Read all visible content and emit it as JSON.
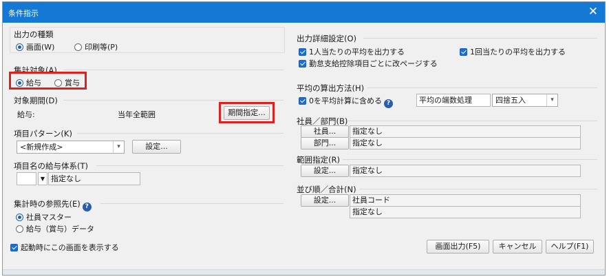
{
  "window": {
    "title": "条件指示",
    "close_glyph": "✕"
  },
  "output_type": {
    "title": "出力の種類",
    "options": [
      {
        "label": "画面(W)",
        "selected": true
      },
      {
        "label": "印刷等(P)",
        "selected": false
      }
    ]
  },
  "aggregate_target": {
    "title": "集計対象(A)",
    "options": [
      {
        "label": "給与",
        "selected": true
      },
      {
        "label": "賞与",
        "selected": false
      }
    ]
  },
  "period": {
    "title": "対象期間(D)",
    "label": "給与:",
    "value": "当年全範囲",
    "button": "期間指定..."
  },
  "item_pattern": {
    "title": "項目パターン(K)",
    "select_value": "<新規作成>",
    "settings_button": "設定..."
  },
  "salary_system": {
    "title": "項目名の給与体系(T)",
    "value": "指定なし"
  },
  "reference": {
    "title": "集計時の参照先(E)",
    "options": [
      {
        "label": "社員マスター",
        "selected": true
      },
      {
        "label": "給与（賞与）データ",
        "selected": false
      }
    ]
  },
  "startup_check": {
    "label": "起動時にこの画面を表示する",
    "checked": true
  },
  "output_details": {
    "title": "出力詳細設定(O)",
    "checks": [
      {
        "label": "1人当たりの平均を出力する",
        "checked": true
      },
      {
        "label": "1回当たりの平均を出力する",
        "checked": true
      },
      {
        "label": "勤怠支給控除項目ごとに改ページする",
        "checked": true
      }
    ]
  },
  "average_method": {
    "title": "平均の算出方法(H)",
    "include_zero": {
      "label": "0を平均計算に含める",
      "checked": true
    },
    "rounding_label": "平均の端数処理",
    "rounding_value": "四捨五入"
  },
  "employee_dept": {
    "title": "社員／部門(B)",
    "rows": [
      {
        "button": "社員...",
        "value": "指定なし"
      },
      {
        "button": "部門...",
        "value": "指定なし"
      }
    ]
  },
  "range": {
    "title": "範囲指定(R)",
    "button": "設定...",
    "value": "指定なし"
  },
  "sort": {
    "title": "並び順／合計(N)",
    "button": "設定...",
    "values": [
      "社員コード",
      "指定なし"
    ]
  },
  "footer": {
    "output_button": "画面出力(F5)",
    "cancel_button": "キャンセル",
    "help_button": "ヘルプ(F1)"
  },
  "highlight_color": "#e0201e",
  "accent_color": "#1479d4"
}
